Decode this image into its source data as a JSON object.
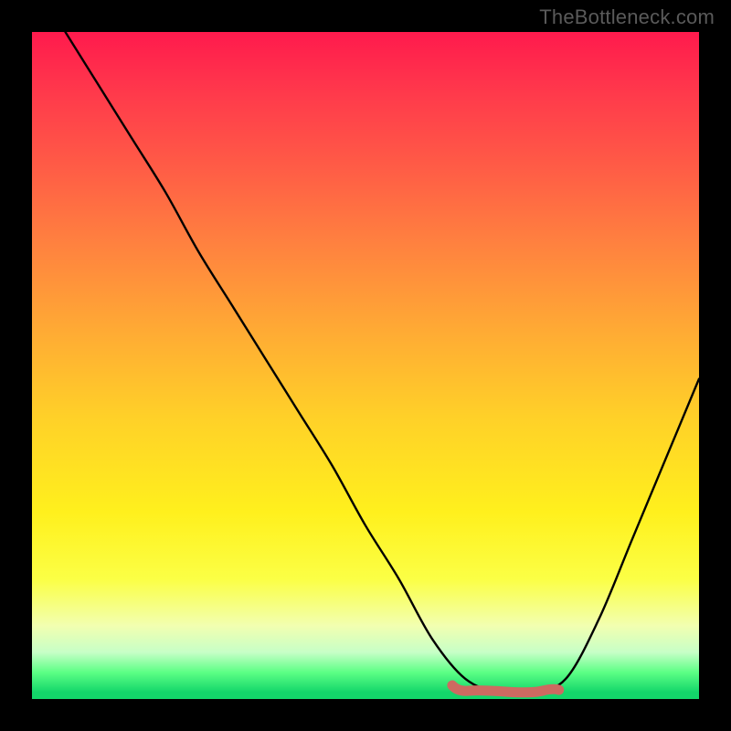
{
  "attribution": "TheBottleneck.com",
  "colors": {
    "background": "#000000",
    "curve": "#000000",
    "marker": "#cd6a61"
  },
  "chart_data": {
    "type": "line",
    "title": "",
    "xlabel": "",
    "ylabel": "",
    "xlim": [
      0,
      100
    ],
    "ylim": [
      0,
      100
    ],
    "grid": false,
    "legend": false,
    "series": [
      {
        "name": "bottleneck-curve",
        "x": [
          5,
          10,
          15,
          20,
          25,
          30,
          35,
          40,
          45,
          50,
          55,
          60,
          65,
          70,
          75,
          80,
          85,
          90,
          95,
          100
        ],
        "y": [
          100,
          92,
          84,
          76,
          67,
          59,
          51,
          43,
          35,
          26,
          18,
          9,
          3,
          1,
          1,
          3,
          12,
          24,
          36,
          48
        ]
      }
    ],
    "marker": {
      "name": "recommended-range",
      "x_start": 63,
      "x_end": 79,
      "y": 1.5
    },
    "background_gradient": {
      "top": "#ff1a4d",
      "mid": "#fff01d",
      "bottom": "#13d66a"
    }
  }
}
